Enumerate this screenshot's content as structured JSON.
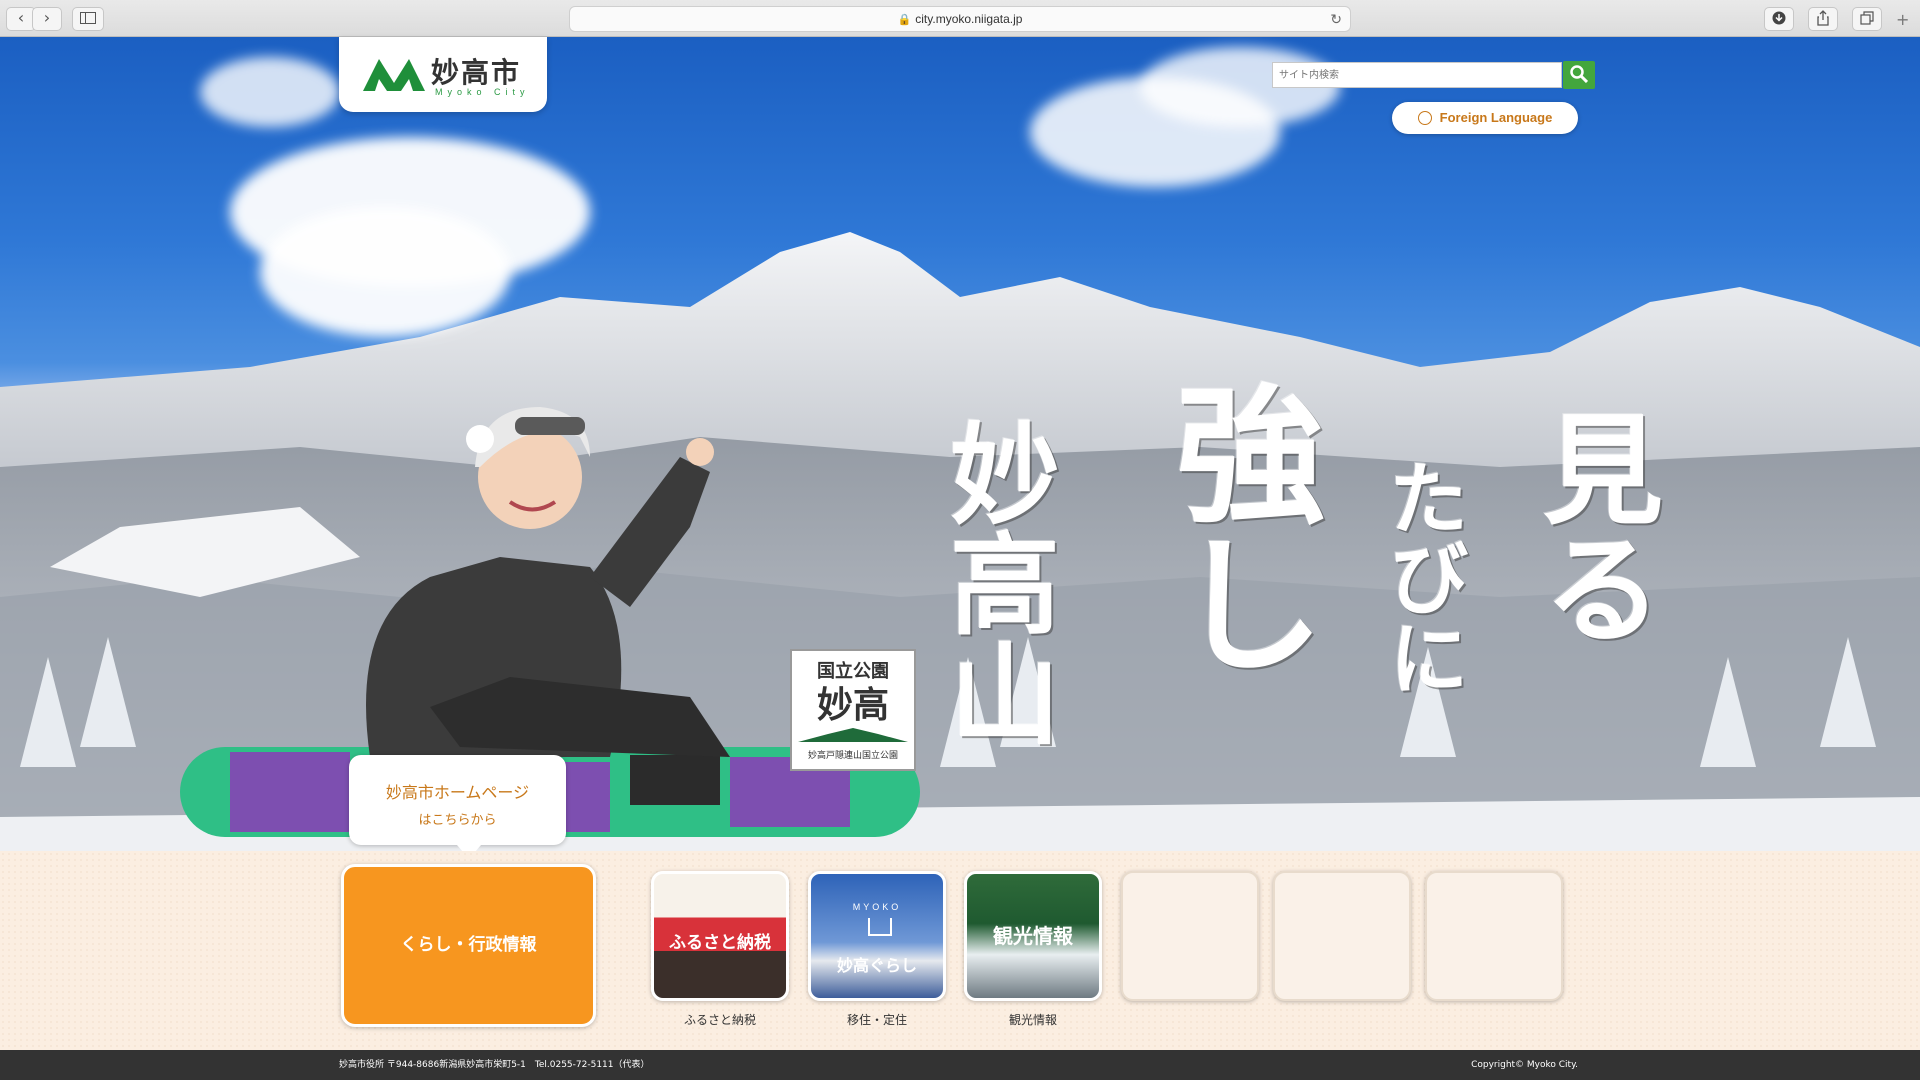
{
  "browser": {
    "url": "city.myoko.niigata.jp",
    "back_icon": "‹",
    "forward_icon": "›"
  },
  "header": {
    "logo_text": "妙高市",
    "logo_sub": "Myoko City",
    "search_placeholder": "サイト内検索",
    "foreign_language": "Foreign Language"
  },
  "hero": {
    "callig_1": "見る",
    "callig_2": "たびに",
    "callig_3": "強し",
    "callig_4": "妙高山",
    "badge_top": "国立公園",
    "badge_main": "妙高",
    "badge_bottom": "妙高戸隠連山国立公園"
  },
  "bubble": {
    "line1": "妙高市ホームページ",
    "line2": "はこちらから"
  },
  "main_tile": {
    "label": "くらし・行政情報"
  },
  "tiles": [
    {
      "caption": "ふるさと納税",
      "overlay": "ふるさと納税"
    },
    {
      "caption": "移住・定住",
      "overlay": "妙高ぐらし",
      "small": "MYOKO"
    },
    {
      "caption": "観光情報",
      "overlay": "観光情報"
    }
  ],
  "footer": {
    "address": "妙高市役所 〒944-8686新潟県妙高市栄町5-1　Tel.0255-72-5111（代表）",
    "copyright": "Copyright© Myoko City."
  },
  "colors": {
    "accent_green": "#43a63d",
    "orange": "#f7961f"
  }
}
